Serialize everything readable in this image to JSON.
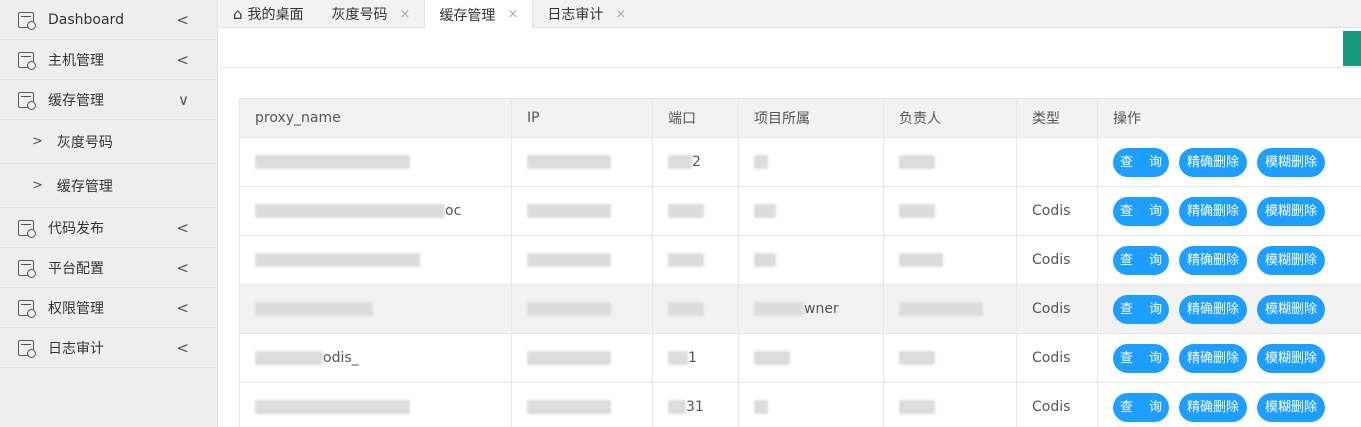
{
  "sidebar": {
    "items": [
      {
        "label": "Dashboard",
        "chevron": "<"
      },
      {
        "label": "主机管理",
        "chevron": "<"
      },
      {
        "label": "缓存管理",
        "chevron": "∨"
      },
      {
        "label": "代码发布",
        "chevron": "<"
      },
      {
        "label": "平台配置",
        "chevron": "<"
      },
      {
        "label": "权限管理",
        "chevron": "<"
      },
      {
        "label": "日志审计",
        "chevron": "<"
      }
    ],
    "sub_items": [
      {
        "label": "灰度号码",
        "arrow": ">"
      },
      {
        "label": "缓存管理",
        "arrow": ">"
      }
    ]
  },
  "tabs": [
    {
      "label": "我的桌面",
      "icon": "home-icon"
    },
    {
      "label": "灰度号码",
      "close": "×"
    },
    {
      "label": "缓存管理",
      "close": "×",
      "active": true
    },
    {
      "label": "日志审计",
      "close": "×"
    }
  ],
  "table": {
    "headers": [
      "proxy_name",
      "IP",
      "端口",
      "项目所属",
      "负责人",
      "类型",
      "操作"
    ],
    "rows": [
      {
        "proxy_name": "",
        "ip": "",
        "port": "2",
        "project": "",
        "owner": "",
        "type": ""
      },
      {
        "proxy_name": "oc",
        "ip": "",
        "port": "",
        "project": "",
        "owner": "",
        "type": "Codis"
      },
      {
        "proxy_name": "",
        "ip": "",
        "port": "",
        "project": "",
        "owner": "",
        "type": "Codis"
      },
      {
        "proxy_name": "",
        "ip": "",
        "port": "",
        "project": "wner",
        "owner": "",
        "type": "Codis"
      },
      {
        "proxy_name": "odis_",
        "ip": "",
        "port": "1",
        "project": "",
        "owner": "",
        "type": "Codis"
      },
      {
        "proxy_name": "",
        "ip": "",
        "port": "31",
        "project": "",
        "owner": "",
        "type": "Codis"
      }
    ],
    "actions": {
      "query": "查 询",
      "exact_delete": "精确删除",
      "fuzzy_delete": "模糊删除"
    }
  }
}
